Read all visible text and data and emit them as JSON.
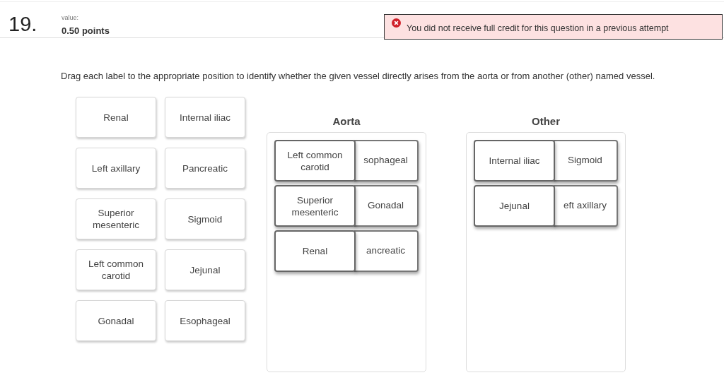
{
  "question": {
    "number": "19.",
    "value_label": "value:",
    "points": "0.50 points"
  },
  "alert": {
    "text": "You did not receive full credit for this question in a previous attempt"
  },
  "instruction": "Drag each label to the appropriate position to identify whether the given vessel directly arises from the aorta or from another (other) named vessel.",
  "label_bank": [
    "Renal",
    "Internal iliac",
    "Left axillary",
    "Pancreatic",
    "Superior mesenteric",
    "Sigmoid",
    "Left common carotid",
    "Jejunal",
    "Gonadal",
    "Esophageal"
  ],
  "zones": [
    {
      "title": "Aorta",
      "rows": [
        {
          "front": "Left common carotid",
          "back": "sophageal"
        },
        {
          "front": "Superior mesenteric",
          "back": "Gonadal"
        },
        {
          "front": "Renal",
          "back": "ancreatic"
        }
      ]
    },
    {
      "title": "Other",
      "rows": [
        {
          "front": "Internal iliac",
          "back": "Sigmoid"
        },
        {
          "front": "Jejunal",
          "back": "eft axillary"
        }
      ]
    }
  ]
}
